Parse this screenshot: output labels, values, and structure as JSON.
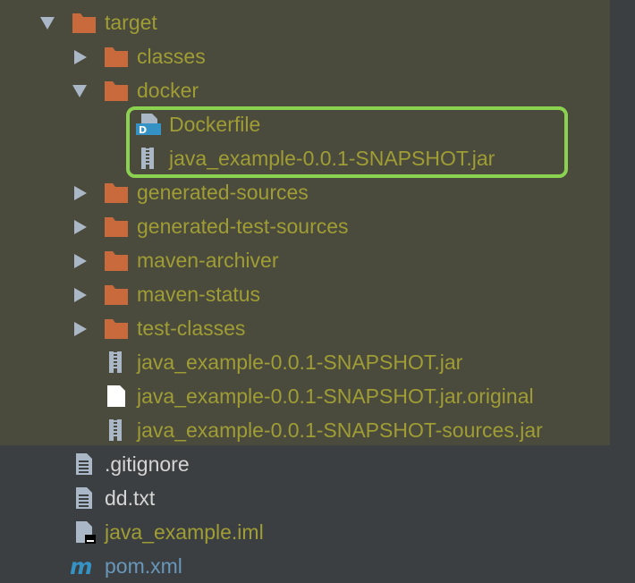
{
  "tree": {
    "target": "target",
    "classes": "classes",
    "docker": "docker",
    "dockerfile": "Dockerfile",
    "docker_jar": "java_example-0.0.1-SNAPSHOT.jar",
    "generated_sources": "generated-sources",
    "generated_test_sources": "generated-test-sources",
    "maven_archiver": "maven-archiver",
    "maven_status": "maven-status",
    "test_classes": "test-classes",
    "jar": "java_example-0.0.1-SNAPSHOT.jar",
    "jar_original": "java_example-0.0.1-SNAPSHOT.jar.original",
    "sources_jar": "java_example-0.0.1-SNAPSHOT-sources.jar",
    "gitignore": ".gitignore",
    "dd_txt": "dd.txt",
    "iml": "java_example.iml",
    "pom": "pom.xml"
  },
  "icons": {
    "dockerfile_letter": "D",
    "maven_letter": "m"
  },
  "colors": {
    "background": "#3c3f41",
    "excluded_background": "#4a4a3d",
    "excluded_text": "#9f9d34",
    "normal_text": "#d5d5d5",
    "pom_text": "#6897bb",
    "folder": "#c86a3b",
    "highlight_border": "#8ad24f"
  }
}
